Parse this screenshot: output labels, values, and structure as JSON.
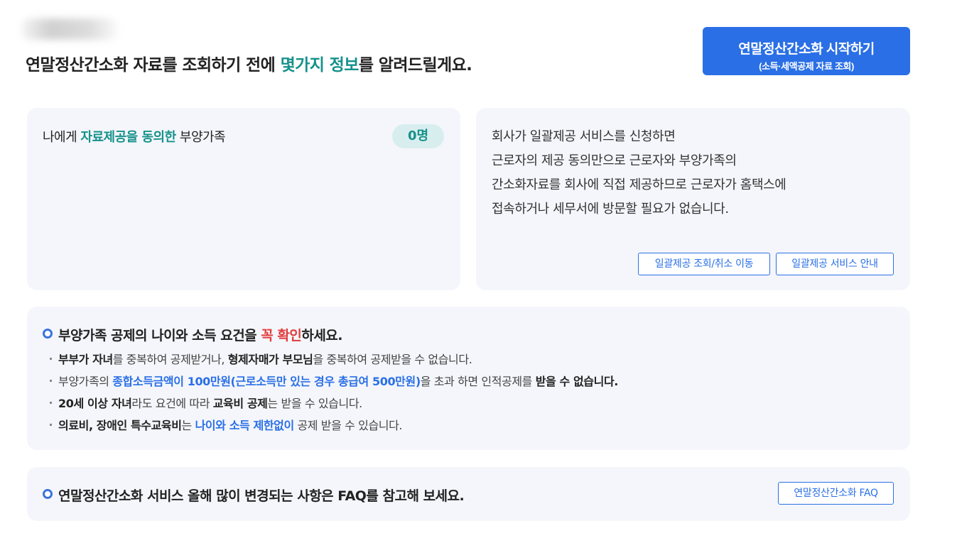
{
  "header": {
    "heading_before": "연말정산간소화 자료를 조회하기 전에 ",
    "heading_highlight": "몇가지 정보",
    "heading_after": "를 알려드릴게요.",
    "start_button_label": "연말정산간소화 시작하기",
    "start_button_sub": "(소득·세액공제 자료 조회)"
  },
  "family_card": {
    "title_before": "나에게 ",
    "title_highlight": "자료제공을 동의한",
    "title_after": " 부양가족",
    "count": "0명"
  },
  "company_card": {
    "lines": [
      "회사가 일괄제공 서비스를 신청하면",
      "근로자의 제공 동의만으로 근로자와 부양가족의",
      "간소화자료를 회사에 직접 제공하므로 근로자가 홈택스에",
      "접속하거나 세무서에 방문할 필요가 없습니다."
    ],
    "lookup_button": "일괄제공 조회/취소 이동",
    "guide_button": "일괄제공 서비스 안내"
  },
  "rules_card": {
    "title_before": "부양가족 공제의 나이와 소득 요건을 ",
    "title_red": "꼭 확인",
    "title_after": "하세요.",
    "rule1": {
      "b1": "부부가 자녀",
      "t1": "를 중복하여 공제받거나, ",
      "b2": "형제자매가 부모님",
      "t2": "을 중복하여 공제받을 수 없습니다."
    },
    "rule2": {
      "t1": "부양가족의 ",
      "blue": "종합소득금액이 100만원(근로소득만 있는 경우 총급여 500만원)",
      "t2": "을 초과 하면 인적공제를 ",
      "b1": "받을 수 없습니다."
    },
    "rule3": {
      "b1": "20세 이상 자녀",
      "t1": "라도 요건에 따라 ",
      "b2": "교육비 공제",
      "t2": "는 받을 수 있습니다."
    },
    "rule4": {
      "b1": "의료비, 장애인 특수교육비",
      "t1": "는 ",
      "blue": "나이와 소득 제한없이",
      "t2": " 공제 받을 수 있습니다."
    }
  },
  "faq_card": {
    "text": "연말정산간소화 서비스 올해 많이 변경되는 사항은 FAQ를 참고해 보세요.",
    "button": "연말정산간소화 FAQ"
  }
}
